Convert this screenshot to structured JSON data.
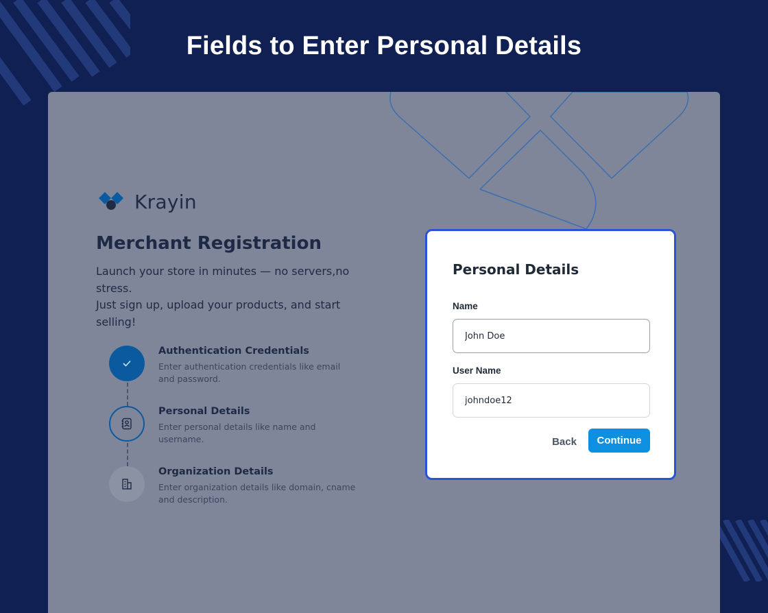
{
  "banner": {
    "title": "Fields to Enter Personal Details"
  },
  "brand": {
    "name": "Krayin"
  },
  "left": {
    "title": "Merchant Registration",
    "description_line1": "Launch your store in minutes — no servers,no stress.",
    "description_line2": "Just sign up, upload your products, and start selling!"
  },
  "steps": [
    {
      "title": "Authentication Credentials",
      "description": "Enter authentication credentials like email and password.",
      "state": "completed",
      "icon": "check-icon"
    },
    {
      "title": "Personal Details",
      "description": "Enter personal details like name and username.",
      "state": "current",
      "icon": "contact-book-icon"
    },
    {
      "title": "Organization Details",
      "description": "Enter organization details like domain, cname and description.",
      "state": "pending",
      "icon": "building-icon"
    }
  ],
  "form": {
    "title": "Personal Details",
    "name_label": "Name",
    "name_value": "John Doe",
    "username_label": "User Name",
    "username_value": "johndoe12",
    "back_label": "Back",
    "continue_label": "Continue"
  },
  "colors": {
    "page_background": "#112053",
    "overlay_background": "#7f8699",
    "accent": "#0f8fe0",
    "highlight_border": "#2a52d6",
    "step_completed": "#0b5aa0"
  }
}
